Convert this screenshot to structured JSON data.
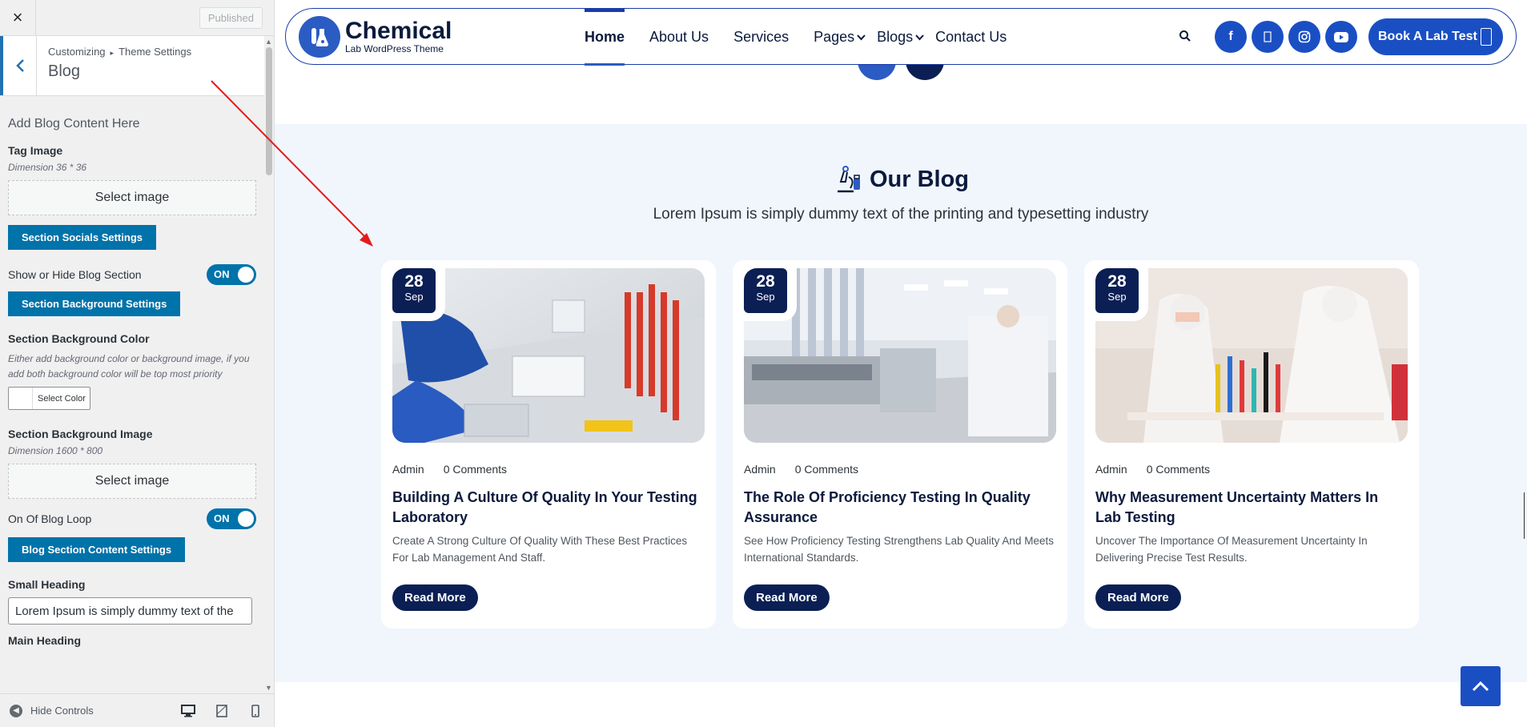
{
  "customizer": {
    "close_glyph": "×",
    "published_label": "Published",
    "breadcrumb_root": "Customizing",
    "breadcrumb_separator": "▸",
    "breadcrumb_parent": "Theme Settings",
    "section_title": "Blog",
    "panel_heading": "Add Blog Content Here",
    "tag_image_label": "Tag Image",
    "tag_image_dimension": "Dimension 36 * 36",
    "select_image_label": "Select image",
    "socials_button": "Section Socials Settings",
    "show_hide_label": "Show or Hide Blog Section",
    "toggle_on": "ON",
    "bg_settings_button": "Section Background Settings",
    "bg_color_label": "Section Background Color",
    "bg_color_desc": "Either add background color or background image, if you add both background color will be top most priority",
    "select_color_label": "Select Color",
    "bg_image_label": "Section Background Image",
    "bg_image_dimension": "Dimension 1600 * 800",
    "select_image_label_2": "Select image",
    "loop_label": "On Of Blog Loop",
    "content_settings_button": "Blog Section Content Settings",
    "small_heading_label": "Small Heading",
    "small_heading_value": "Lorem Ipsum is simply dummy text of the",
    "main_heading_label": "Main Heading",
    "hide_controls_label": "Hide Controls"
  },
  "site": {
    "logo_title": "Chemical",
    "logo_subtitle": "Lab WordPress Theme",
    "nav": [
      {
        "label": "Home"
      },
      {
        "label": "About Us"
      },
      {
        "label": "Services"
      },
      {
        "label": "Pages"
      },
      {
        "label": "Blogs"
      },
      {
        "label": "Contact Us"
      }
    ],
    "book_button": "Book A Lab Test",
    "blog_title": "Our Blog",
    "blog_subtitle": "Lorem Ipsum is simply dummy text of the printing and typesetting industry",
    "posts": [
      {
        "day": "28",
        "month": "Sep",
        "author": "Admin",
        "comments": "0 Comments",
        "title": "Building A Culture Of Quality In Your Testing Laboratory",
        "excerpt": "Create A Strong Culture Of Quality With These Best Practices For Lab Management And Staff.",
        "read_more": "Read More"
      },
      {
        "day": "28",
        "month": "Sep",
        "author": "Admin",
        "comments": "0 Comments",
        "title": "The Role Of Proficiency Testing In Quality Assurance",
        "excerpt": "See How Proficiency Testing Strengthens Lab Quality And Meets International Standards.",
        "read_more": "Read More"
      },
      {
        "day": "28",
        "month": "Sep",
        "author": "Admin",
        "comments": "0 Comments",
        "title": "Why Measurement Uncertainty Matters In Lab Testing",
        "excerpt": "Uncover The Importance Of Measurement Uncertainty In Delivering Precise Test Results.",
        "read_more": "Read More"
      }
    ]
  },
  "colors": {
    "brand_blue": "#1a4fc4",
    "navy": "#0b1f54",
    "wp_blue": "#0073aa",
    "annotation_red": "#e31b1b"
  }
}
